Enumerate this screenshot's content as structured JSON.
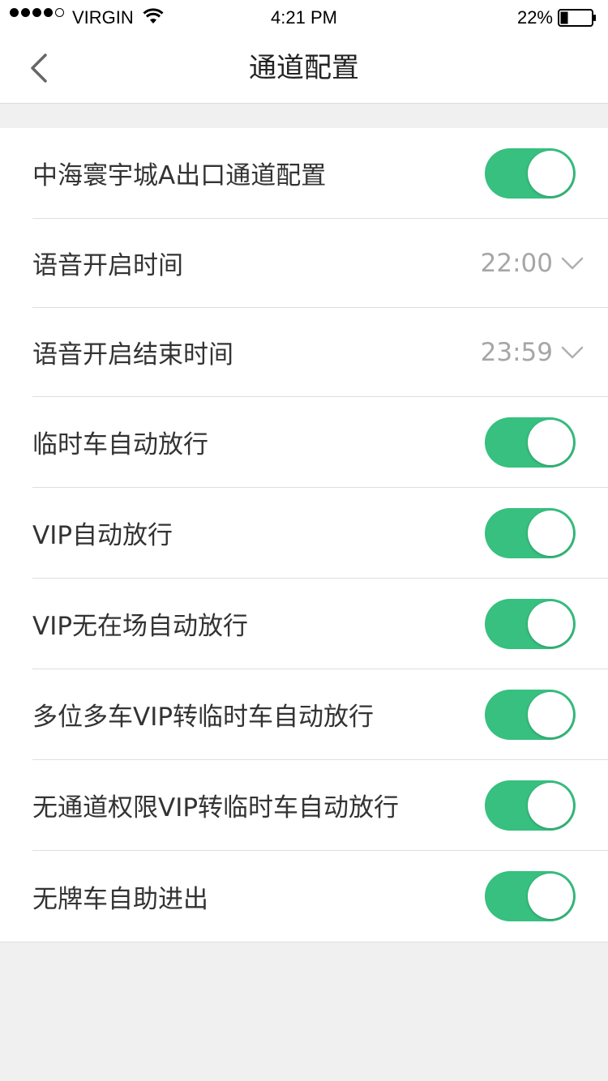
{
  "status_bar": {
    "carrier": "VIRGIN",
    "time": "4:21 PM",
    "battery": "22%",
    "signal_strength": 4,
    "signal_max": 5,
    "battery_level": 0.22
  },
  "header": {
    "title": "通道配置",
    "back_icon": "chevron-left-icon"
  },
  "accent_color": "#37c07f",
  "settings": [
    {
      "label": "中海寰宇城A出口通道配置",
      "type": "toggle",
      "on": true
    },
    {
      "label": "语音开启时间",
      "type": "time",
      "value": "22:00"
    },
    {
      "label": "语音开启结束时间",
      "type": "time",
      "value": "23:59"
    },
    {
      "label": "临时车自动放行",
      "type": "toggle",
      "on": true
    },
    {
      "label": "VIP自动放行",
      "type": "toggle",
      "on": true
    },
    {
      "label": "VIP无在场自动放行",
      "type": "toggle",
      "on": true
    },
    {
      "label": "多位多车VIP转临时车自动放行",
      "type": "toggle",
      "on": true
    },
    {
      "label": "无通道权限VIP转临时车自动放行",
      "type": "toggle",
      "on": true
    },
    {
      "label": "无牌车自助进出",
      "type": "toggle",
      "on": true
    }
  ]
}
